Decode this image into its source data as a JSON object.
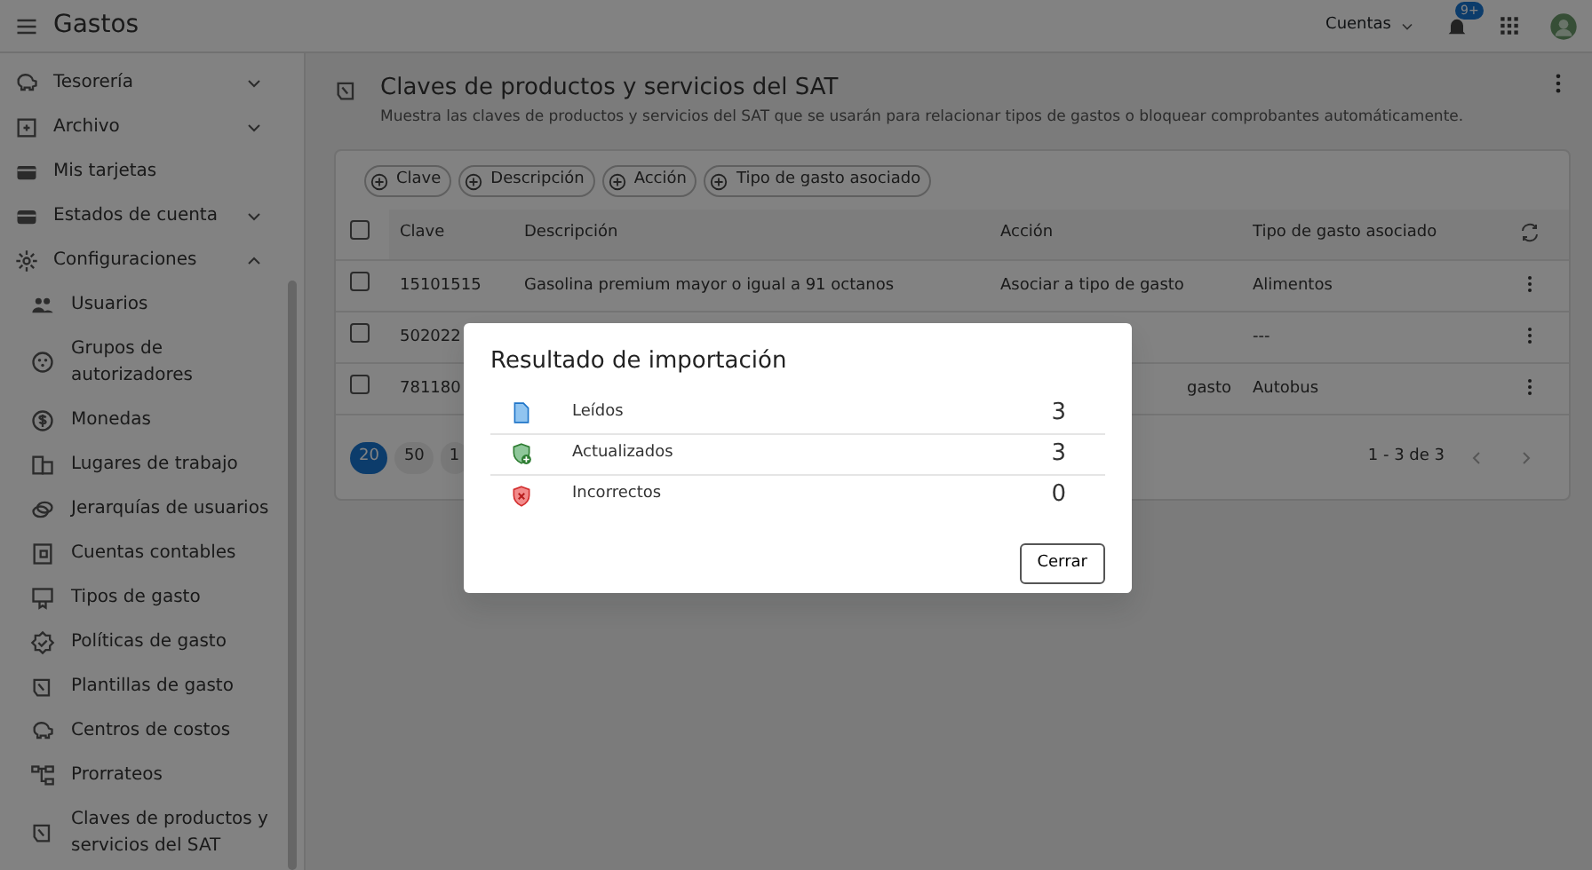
{
  "app_bar": {
    "title": "Gastos",
    "account_menu": "Cuentas",
    "notification_badge": "9+"
  },
  "sidebar": {
    "items": [
      {
        "label": "Tesorería",
        "expanded": false
      },
      {
        "label": "Archivo",
        "expanded": false
      },
      {
        "label": "Mis tarjetas"
      },
      {
        "label": "Estados de cuenta",
        "expanded": false
      },
      {
        "label": "Configuraciones",
        "expanded": true,
        "children": [
          {
            "label": "Usuarios"
          },
          {
            "label": "Grupos de autorizadores"
          },
          {
            "label": "Monedas"
          },
          {
            "label": "Lugares de trabajo"
          },
          {
            "label": "Jerarquías de usuarios"
          },
          {
            "label": "Cuentas contables"
          },
          {
            "label": "Tipos de gasto"
          },
          {
            "label": "Políticas de gasto"
          },
          {
            "label": "Plantillas de gasto"
          },
          {
            "label": "Centros de costos"
          },
          {
            "label": "Prorrateos"
          },
          {
            "label": "Claves de productos y servicios del SAT"
          }
        ]
      }
    ]
  },
  "page": {
    "title": "Claves de productos y servicios del SAT",
    "description": "Muestra las claves de productos y servicios del SAT que se usarán para relacionar tipos de gastos o bloquear comprobantes automáticamente."
  },
  "filters": [
    "Clave",
    "Descripción",
    "Acción",
    "Tipo de gasto asociado"
  ],
  "table": {
    "select_all_checked": false,
    "columns": [
      "Clave",
      "Descripción",
      "Acción",
      "Tipo de gasto asociado"
    ],
    "rows": [
      {
        "checked": false,
        "clave": "15101515",
        "descripcion": "Gasolina premium mayor o igual a 91 octanos",
        "accion": "Asociar a tipo de gasto",
        "tipo": "Alimentos"
      },
      {
        "checked": false,
        "clave": "502022",
        "tipo": "---"
      },
      {
        "checked": false,
        "clave": "781180",
        "accion": "gasto",
        "tipo": "Autobus"
      }
    ]
  },
  "pagination": {
    "page_sizes": [
      {
        "label": "20",
        "selected": true
      },
      {
        "label": "50",
        "selected": false
      },
      {
        "label": "1",
        "selected": false
      }
    ],
    "range": "1 - 3 de 3"
  },
  "dialog": {
    "title": "Resultado de importación",
    "rows": [
      {
        "kind": "read",
        "label": "Leídos",
        "count": "3"
      },
      {
        "kind": "updated",
        "label": "Actualizados",
        "count": "3"
      },
      {
        "kind": "error",
        "label": "Incorrectos",
        "count": "0"
      }
    ],
    "button": "Cerrar"
  }
}
